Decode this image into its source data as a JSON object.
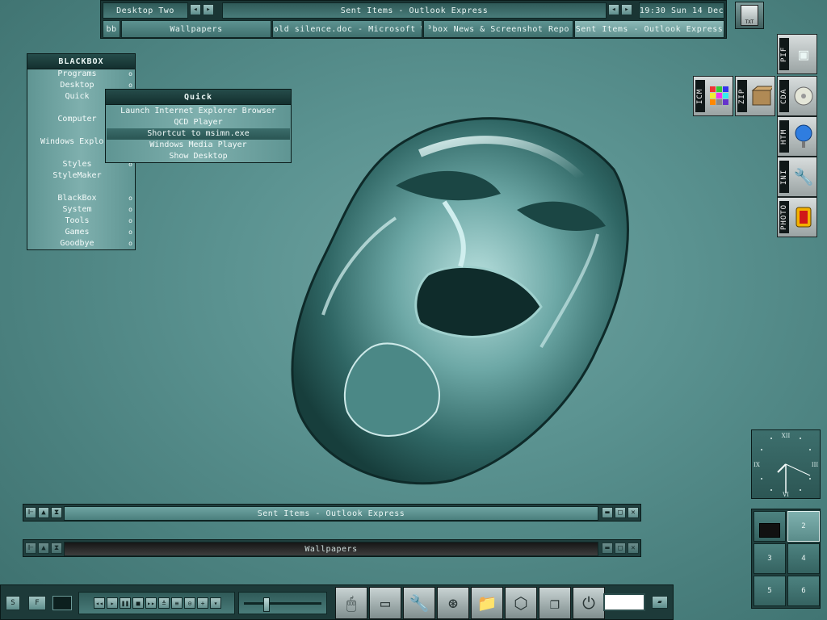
{
  "toolbar": {
    "workspace_label": "Desktop Two",
    "window_title": "Sent Items - Outlook Express",
    "clock": "19:30 Sun 14 Dec",
    "bb_label": "bb",
    "tasks": [
      {
        "label": "Wallpapers",
        "active": false
      },
      {
        "label": "cold silence.doc - Microsoft W",
        "active": false
      },
      {
        "label": "³box News & Screenshot Repo",
        "active": false
      },
      {
        "label": "Sent Items - Outlook Express",
        "active": true
      }
    ]
  },
  "blackbox_menu": {
    "title": "BLACKBOX",
    "items": [
      {
        "label": "Programs",
        "submenu": true
      },
      {
        "label": "Desktop",
        "submenu": true
      },
      {
        "label": "Quick",
        "submenu": true
      },
      {
        "label": "",
        "submenu": false
      },
      {
        "label": "Computer",
        "submenu": false
      },
      {
        "label": "",
        "submenu": false
      },
      {
        "label": "Windows Explorer",
        "submenu": false
      },
      {
        "label": "",
        "submenu": false
      },
      {
        "label": "Styles",
        "submenu": true
      },
      {
        "label": "StyleMaker",
        "submenu": false
      },
      {
        "label": "",
        "submenu": false
      },
      {
        "label": "BlackBox",
        "submenu": true
      },
      {
        "label": "System",
        "submenu": true
      },
      {
        "label": "Tools",
        "submenu": true
      },
      {
        "label": "Games",
        "submenu": true
      },
      {
        "label": "Goodbye",
        "submenu": true
      }
    ],
    "submenu_marker": "o"
  },
  "quick_menu": {
    "title": "Quick",
    "items": [
      {
        "label": "Launch Internet Explorer Browser",
        "selected": false
      },
      {
        "label": "QCD Player",
        "selected": false
      },
      {
        "label": "Shortcut to msimn.exe",
        "selected": true
      },
      {
        "label": "Windows Media Player",
        "selected": false
      },
      {
        "label": "Show Desktop",
        "selected": false
      }
    ]
  },
  "windows": [
    {
      "title": "Sent Items - Outlook Express",
      "active": true
    },
    {
      "title": "Wallpapers",
      "active": false
    }
  ],
  "desktop_icons": [
    {
      "ext": "PIF",
      "name": "pif-file-icon"
    },
    {
      "ext": "ICM",
      "name": "icm-file-icon"
    },
    {
      "ext": "ZIP",
      "name": "zip-file-icon"
    },
    {
      "ext": "CDA",
      "name": "cda-file-icon"
    },
    {
      "ext": "HTM",
      "name": "htm-file-icon"
    },
    {
      "ext": "INI",
      "name": "ini-file-icon"
    },
    {
      "ext": "PHOTO",
      "name": "photo-file-icon"
    }
  ],
  "top_right_icon": {
    "ext": "TXT"
  },
  "clock_widget": {
    "numerals": {
      "top": "XII",
      "right": "III",
      "bottom": "VI",
      "left": "IX"
    },
    "time": "19:30"
  },
  "pager": {
    "desktops": [
      "1",
      "2",
      "3",
      "4",
      "5",
      "6"
    ],
    "current": "2"
  },
  "bottombar": {
    "left_buttons": [
      "S",
      "F"
    ],
    "player_buttons": [
      "|◀◀",
      "▶",
      "❚❚",
      "■",
      "▶▶|",
      "≡",
      "≡",
      "⊙",
      "+",
      "–"
    ],
    "launchers": [
      "mouse-icon",
      "drive-icon",
      "tools-icon",
      "film-reel-icon",
      "folder-icon",
      "network-icon",
      "documents-icon",
      "power-icon"
    ]
  },
  "colors": {
    "accent": "#5b9391",
    "dark": "#1a3534",
    "selected": "#2a5553"
  }
}
